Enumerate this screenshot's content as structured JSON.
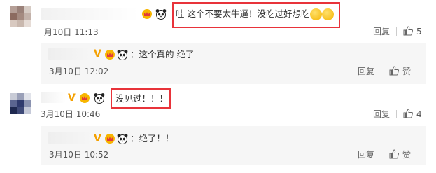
{
  "comments": [
    {
      "text": "哇 这个不要太牛逼！没吃过好想吃",
      "time": "月10日 11:13",
      "reply_label": "回复",
      "like_count": "5"
    },
    {
      "text": "：这个真的 绝了",
      "time": "3月10日 12:02",
      "reply_label": "回复",
      "like_label": "赞"
    },
    {
      "text": "没见过！！！",
      "time": "3月10日 10:46",
      "reply_label": "回复",
      "like_count": "4"
    },
    {
      "text": "：绝了！！",
      "time": "3月10日 10:52",
      "reply_label": "回复",
      "like_label": "赞"
    }
  ],
  "colors": {
    "highlight": "#e8333a",
    "reply_bg": "#f6f6f6"
  },
  "icons": [
    "reply-icon",
    "like-icon",
    "panda-icon",
    "crown-badge-icon",
    "v-badge-icon",
    "emoji-icon"
  ]
}
